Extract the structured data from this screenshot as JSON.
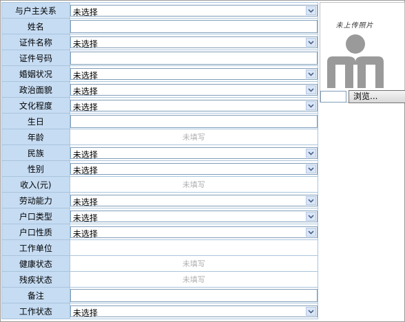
{
  "placeholder_select": "未选择",
  "placeholder_unfilled": "未填写",
  "rows": [
    {
      "label": "与户主关系",
      "type": "select",
      "value": "未选择"
    },
    {
      "label": "姓名",
      "type": "input",
      "value": ""
    },
    {
      "label": "证件名称",
      "type": "select",
      "value": "未选择"
    },
    {
      "label": "证件号码",
      "type": "input",
      "value": ""
    },
    {
      "label": "婚姻状况",
      "type": "select",
      "value": "未选择"
    },
    {
      "label": "政治面貌",
      "type": "select",
      "value": "未选择"
    },
    {
      "label": "文化程度",
      "type": "select",
      "value": "未选择"
    },
    {
      "label": "生日",
      "type": "input",
      "value": ""
    },
    {
      "label": "年龄",
      "type": "static",
      "value": "未填写"
    },
    {
      "label": "民族",
      "type": "select",
      "value": "未选择"
    },
    {
      "label": "性别",
      "type": "select",
      "value": "未选择"
    },
    {
      "label": "收入(元)",
      "type": "static",
      "value": "未填写"
    },
    {
      "label": "劳动能力",
      "type": "select",
      "value": "未选择"
    },
    {
      "label": "户口类型",
      "type": "select",
      "value": "未选择"
    },
    {
      "label": "户口性质",
      "type": "select",
      "value": "未选择"
    },
    {
      "label": "工作单位",
      "type": "blank",
      "value": ""
    },
    {
      "label": "健康状态",
      "type": "static",
      "value": "未填写"
    },
    {
      "label": "残疾状态",
      "type": "static",
      "value": "未填写"
    },
    {
      "label": "备注",
      "type": "input",
      "value": ""
    },
    {
      "label": "工作状态",
      "type": "select",
      "value": "未选择"
    }
  ],
  "photo": {
    "caption": "未上传照片",
    "browse_label": "浏览..."
  },
  "colors": {
    "label_bg": "#c6dcf3",
    "border": "#a9c4dc",
    "avatar": "#9a9a9a"
  }
}
